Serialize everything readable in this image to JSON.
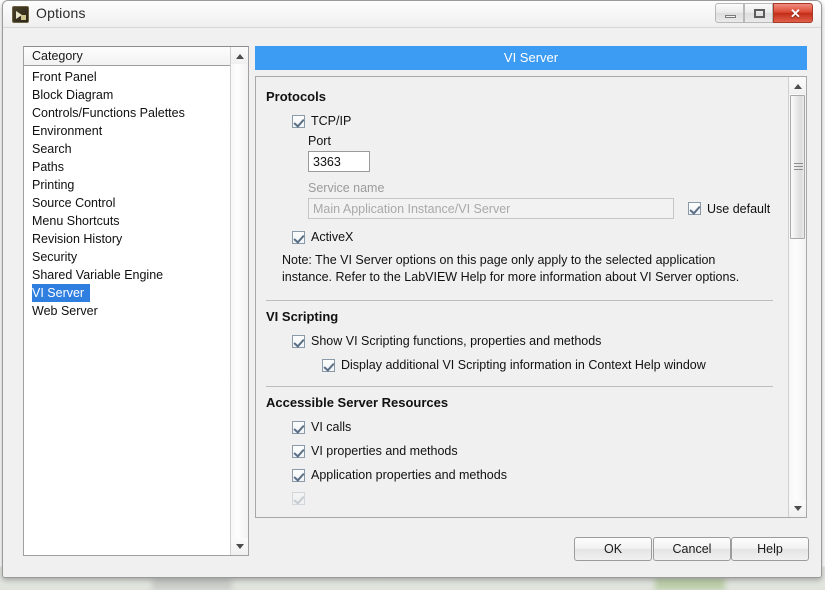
{
  "window": {
    "title": "Options",
    "icon": "labview-app-icon",
    "controls": {
      "minimize": "minimize-icon",
      "maximize": "restore-icon",
      "close": "close-icon",
      "close_glyph": "✕"
    }
  },
  "category": {
    "header": "Category",
    "items": [
      {
        "label": "Front Panel",
        "selected": false
      },
      {
        "label": "Block Diagram",
        "selected": false
      },
      {
        "label": "Controls/Functions Palettes",
        "selected": false
      },
      {
        "label": "Environment",
        "selected": false
      },
      {
        "label": "Search",
        "selected": false
      },
      {
        "label": "Paths",
        "selected": false
      },
      {
        "label": "Printing",
        "selected": false
      },
      {
        "label": "Source Control",
        "selected": false
      },
      {
        "label": "Menu Shortcuts",
        "selected": false
      },
      {
        "label": "Revision History",
        "selected": false
      },
      {
        "label": "Security",
        "selected": false
      },
      {
        "label": "Shared Variable Engine",
        "selected": false
      },
      {
        "label": "VI Server",
        "selected": true
      },
      {
        "label": "Web Server",
        "selected": false
      }
    ],
    "selected_color": "#2f7fe0"
  },
  "page": {
    "title": "VI Server",
    "title_bar_color": "#3c9bf2",
    "sections": {
      "protocols": {
        "heading": "Protocols",
        "tcpip": {
          "label": "TCP/IP",
          "checked": true
        },
        "port": {
          "label": "Port",
          "value": "3363"
        },
        "service_name": {
          "label": "Service name",
          "value": "Main Application Instance/VI Server",
          "disabled": true
        },
        "use_default": {
          "label": "Use default",
          "checked": true
        },
        "activex": {
          "label": "ActiveX",
          "checked": true
        },
        "note": "Note: The VI Server options on this page only apply to the selected application instance. Refer to the LabVIEW Help for more information about VI Server options."
      },
      "vi_scripting": {
        "heading": "VI Scripting",
        "show_functions": {
          "label": "Show VI Scripting functions, properties and methods",
          "checked": true
        },
        "display_additional": {
          "label": "Display additional VI Scripting information in Context Help window",
          "checked": true
        }
      },
      "accessible_server_resources": {
        "heading": "Accessible Server Resources",
        "items": [
          {
            "label": "VI calls",
            "checked": true
          },
          {
            "label": "VI properties and methods",
            "checked": true
          },
          {
            "label": "Application properties and methods",
            "checked": true
          }
        ]
      }
    }
  },
  "footer": {
    "ok": "OK",
    "cancel": "Cancel",
    "help": "Help"
  }
}
